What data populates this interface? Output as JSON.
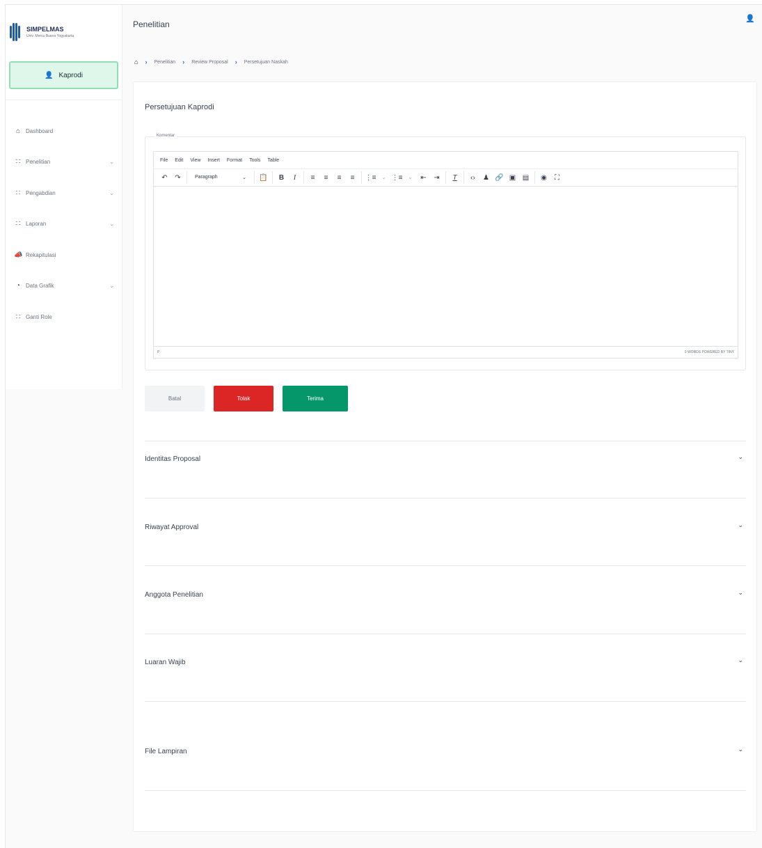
{
  "brand": {
    "title": "SIMPELMAS",
    "subtitle": "Univ. Mercu Buana Yogyakarta",
    "logo_color": "#1f5aa6"
  },
  "role": {
    "label": "Kaprodi",
    "icon": "user-icon"
  },
  "sidebar": {
    "items": [
      {
        "label": "Dashboard",
        "icon": "home-icon",
        "has_children": false
      },
      {
        "label": "Penelitian",
        "icon": "grid-icon",
        "has_children": true
      },
      {
        "label": "Pengabdian",
        "icon": "grid-icon",
        "has_children": true
      },
      {
        "label": "Laporan",
        "icon": "grid-icon",
        "has_children": true
      },
      {
        "label": "Rekapitulasi",
        "icon": "megaphone-icon",
        "has_children": false
      },
      {
        "label": "Data Grafik",
        "icon": "chart-pie-icon",
        "has_children": true
      },
      {
        "label": "Ganti Role",
        "icon": "grid-icon",
        "has_children": false
      }
    ]
  },
  "header": {
    "title": "Penelitian",
    "user_icon": "user-icon"
  },
  "breadcrumb": {
    "home_icon": "home-icon",
    "items": [
      "Penelitian",
      "Review Proposal",
      "Persetujuan Naskah"
    ]
  },
  "card": {
    "title": "Persetujuan Kaprodi"
  },
  "comment": {
    "legend": "Komentar",
    "menubar": [
      "File",
      "Edit",
      "View",
      "Insert",
      "Format",
      "Tools",
      "Table"
    ],
    "block_format": "Paragraph",
    "status_path": "P",
    "status_right": "0 WORDS  POWERED BY TINY"
  },
  "actions": {
    "cancel": "Batal",
    "reject": "Tolak",
    "accept": "Terima",
    "reject_color": "#dc2626",
    "accept_color": "#059669"
  },
  "sections": [
    {
      "label": "Identitas Proposal"
    },
    {
      "label": "Riwayat Approval"
    },
    {
      "label": "Anggota Penelitian"
    },
    {
      "label": "Luaran Wajib"
    },
    {
      "label": "File Lampiran"
    }
  ]
}
